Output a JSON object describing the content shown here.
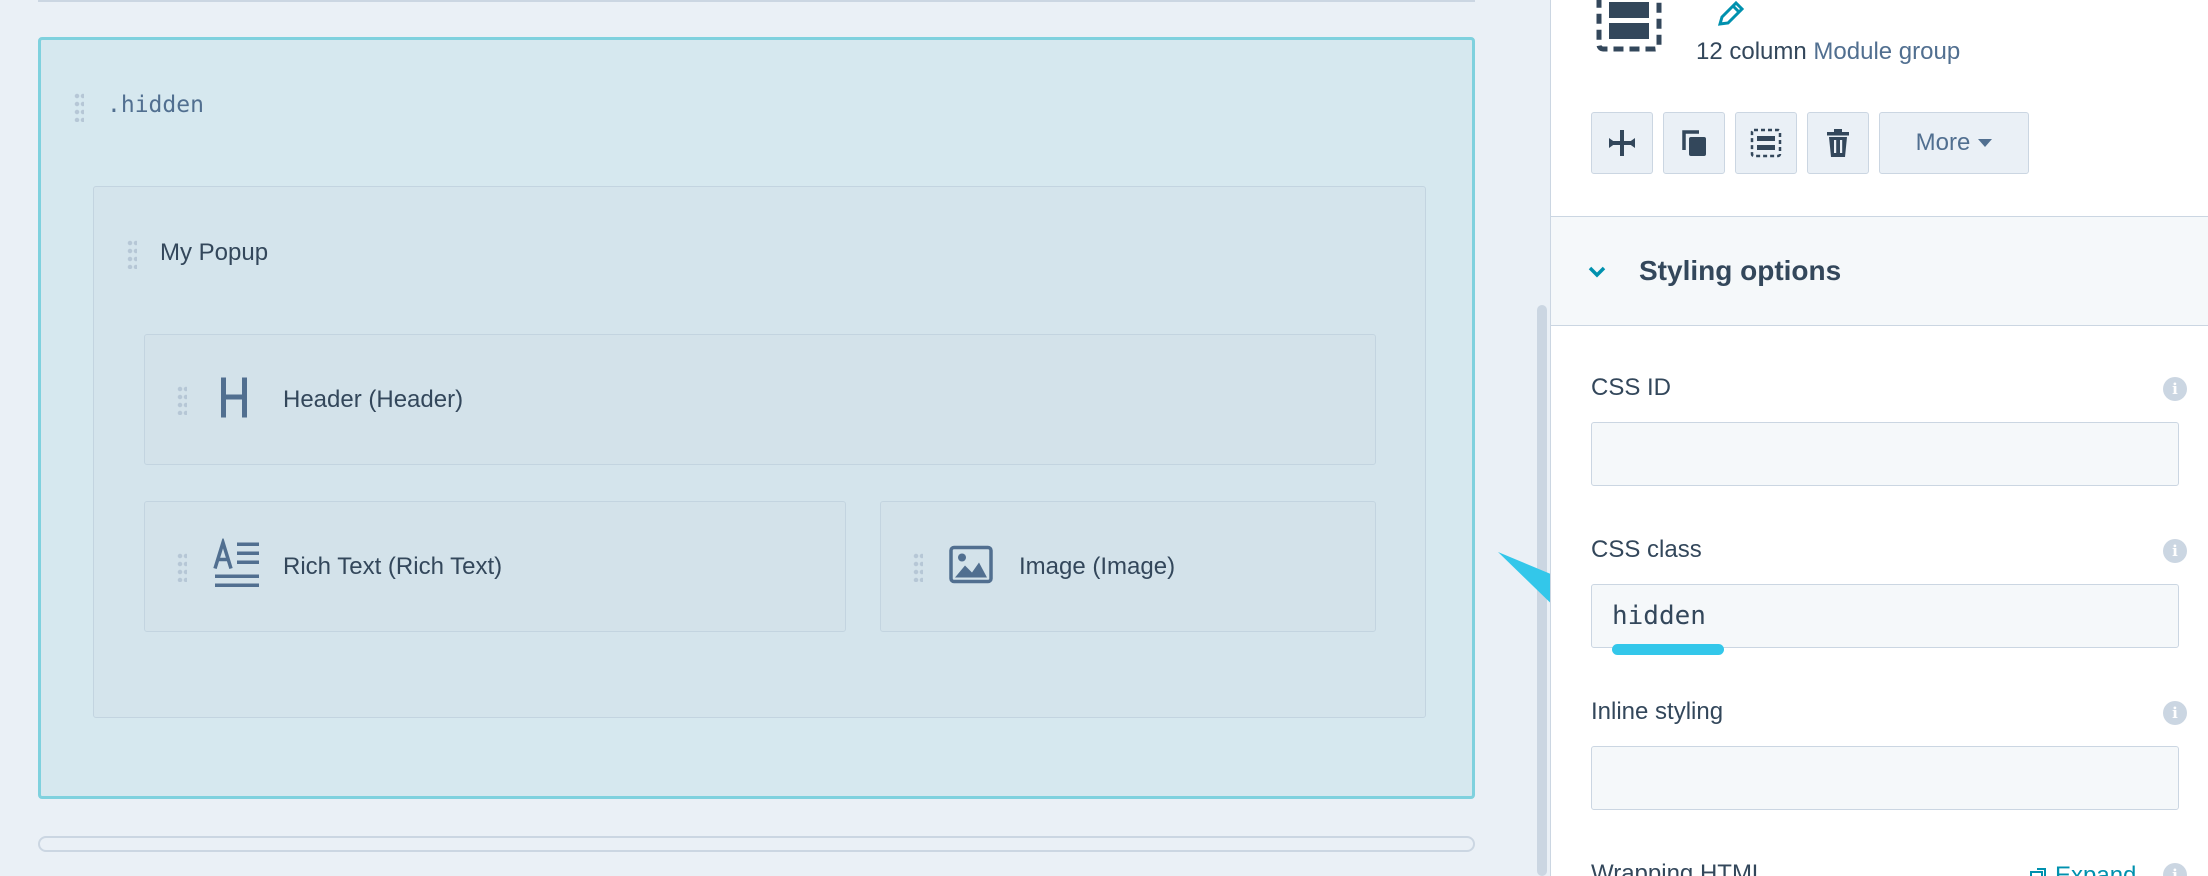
{
  "canvas": {
    "group_label": ".hidden",
    "inner_group_label": "My Popup",
    "modules": {
      "header": "Header (Header)",
      "rich_text": "Rich Text (Rich Text)",
      "image": "Image (Image)"
    }
  },
  "sidebar": {
    "meta_prefix": "12 column",
    "meta_link": "Module group",
    "toolbar": {
      "more_label": "More"
    },
    "section_title": "Styling options",
    "fields": {
      "css_id": {
        "label": "CSS ID",
        "value": ""
      },
      "css_class": {
        "label": "CSS class",
        "value": "hidden"
      },
      "inline_styling": {
        "label": "Inline styling",
        "value": ""
      },
      "wrapping_html": {
        "label": "Wrapping HTML",
        "expand_label": "Expand"
      }
    }
  },
  "colors": {
    "accent_teal": "#7fd1de",
    "link": "#0091ae",
    "arrow": "#33c7ea",
    "text": "#33475b"
  }
}
